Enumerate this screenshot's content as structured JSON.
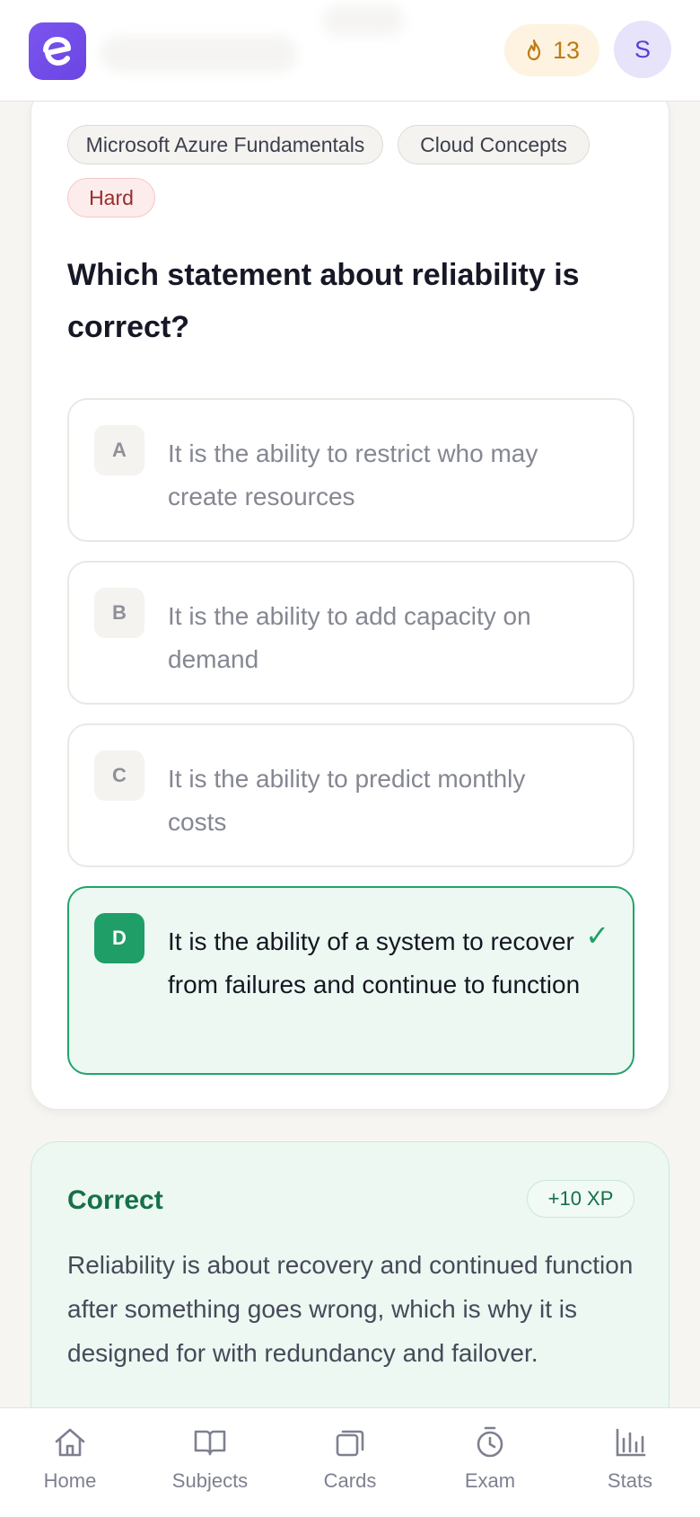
{
  "header": {
    "logo_icon": "logo-e-icon",
    "streak_icon": "flame-icon",
    "streak_count": "13",
    "avatar_initial": "S",
    "colors": {
      "brand": "#6a45e3",
      "streak": "#bf7a12"
    }
  },
  "question": {
    "tags": [
      "Microsoft Azure Fundamentals",
      "Cloud Concepts"
    ],
    "difficulty": "Hard",
    "text": "Which statement about reliability is correct?",
    "options": [
      {
        "letter": "A",
        "text": "It is the ability to restrict who may create resources",
        "state": "neutral"
      },
      {
        "letter": "B",
        "text": "It is the ability to add capacity on demand",
        "state": "neutral"
      },
      {
        "letter": "C",
        "text": "It is the ability to predict monthly costs",
        "state": "neutral"
      },
      {
        "letter": "D",
        "text": "It is the ability of a system to recover from failures and continue to function",
        "state": "correct"
      }
    ],
    "check_mark": "✓"
  },
  "feedback": {
    "title": "Correct",
    "xp": "+10 XP",
    "body": "Reliability is about recovery and continued function after something goes wrong, which is why it is designed for with redundancy and failover.",
    "color": "#167049"
  },
  "nav": {
    "items": [
      {
        "label": "Home",
        "icon": "home-icon"
      },
      {
        "label": "Subjects",
        "icon": "book-icon"
      },
      {
        "label": "Cards",
        "icon": "cards-icon"
      },
      {
        "label": "Exam",
        "icon": "stopwatch-icon"
      },
      {
        "label": "Stats",
        "icon": "bar-chart-icon"
      }
    ]
  }
}
